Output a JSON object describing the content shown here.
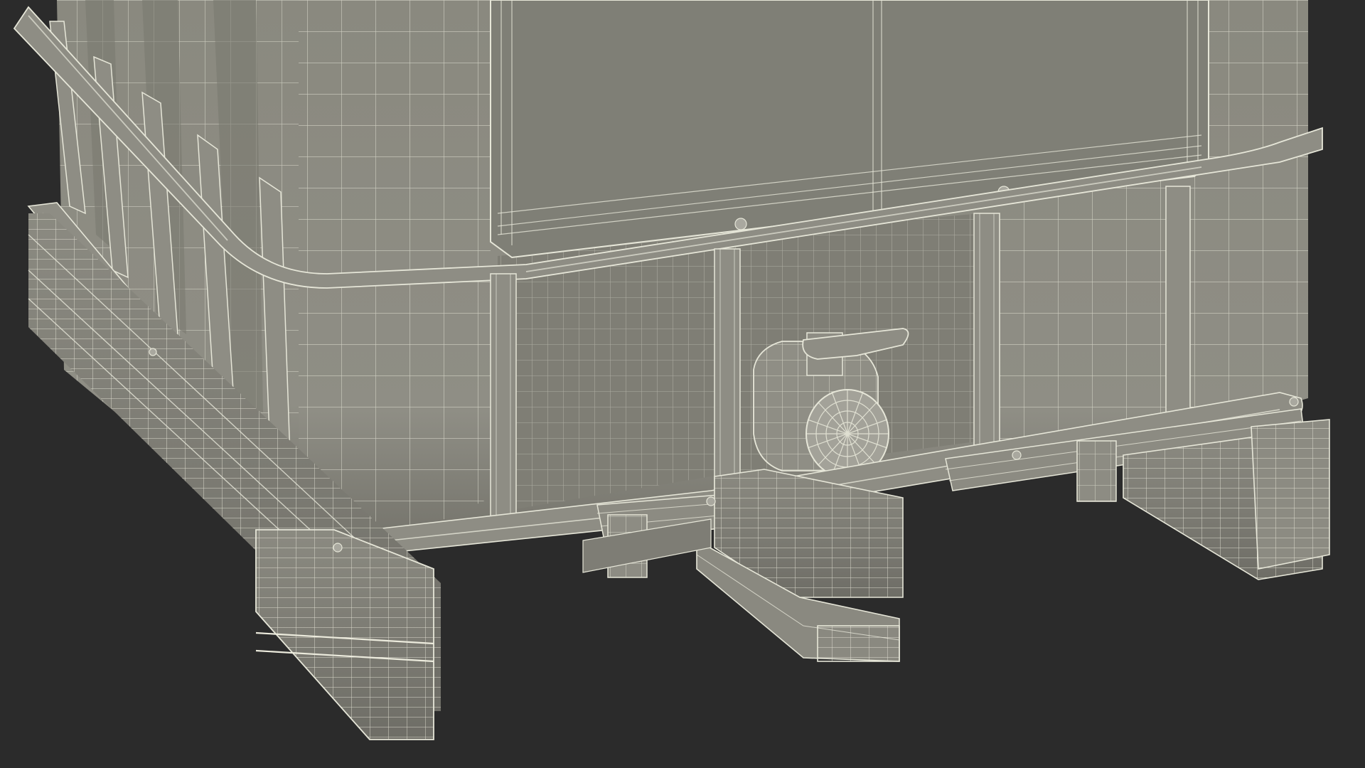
{
  "scene": {
    "subject": "ibc-tank-on-pallet-wireframe",
    "view": "close-up",
    "render_style": "wireframe-over-shaded",
    "colors": {
      "background": "#2b2b2b",
      "tank_surface": "#8c8b82",
      "tank_surface_light": "#a2a198",
      "tank_surface_dark": "#6f6e66",
      "panel_face": "#7f7f76",
      "wire": "#e6e6d8",
      "wire_soft": "#cfcfc2",
      "shadow": "#55544e"
    }
  }
}
